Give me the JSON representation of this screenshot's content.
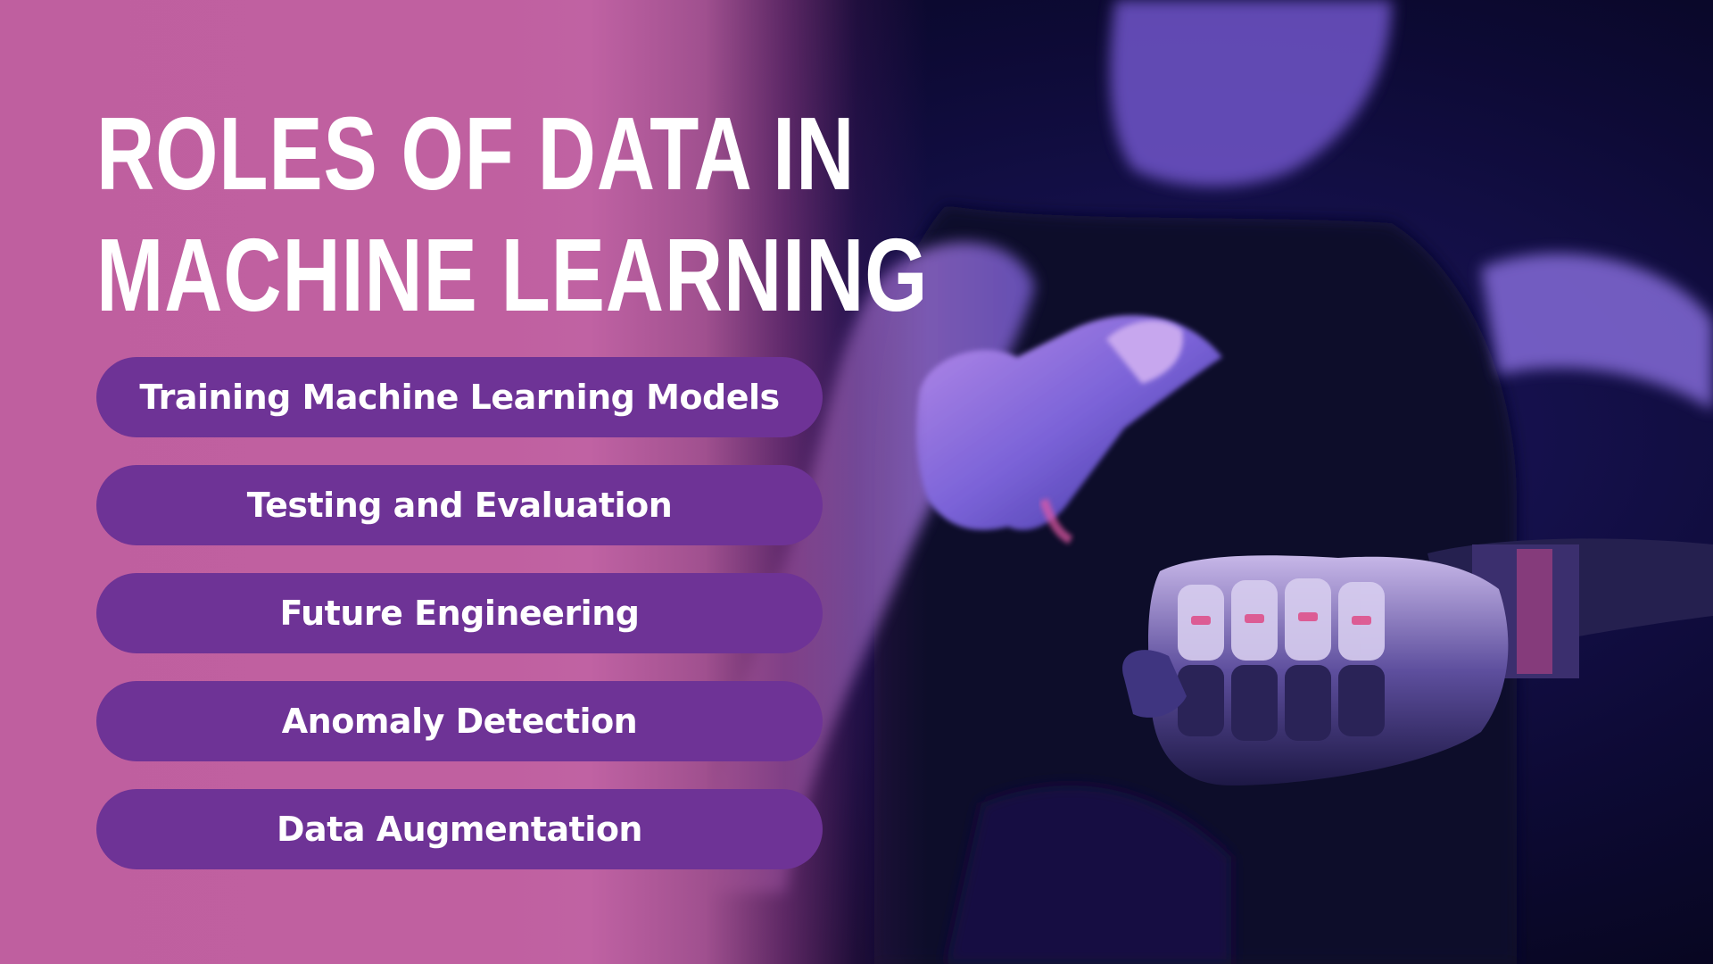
{
  "slide": {
    "title_line1": "ROLES OF DATA IN",
    "title_line2": "MACHINE LEARNING",
    "items": [
      {
        "label": "Training Machine Learning Models"
      },
      {
        "label": "Testing and Evaluation"
      },
      {
        "label": "Future Engineering"
      },
      {
        "label": "Anomaly Detection"
      },
      {
        "label": "Data Augmentation"
      }
    ]
  },
  "colors": {
    "panel_background": "#c060a0",
    "pill_background": "#6e3396",
    "text": "#ffffff",
    "photo_background": "#07061e"
  },
  "icons": {
    "background_image": "person-pointing-with-robotic-hand-photo"
  }
}
